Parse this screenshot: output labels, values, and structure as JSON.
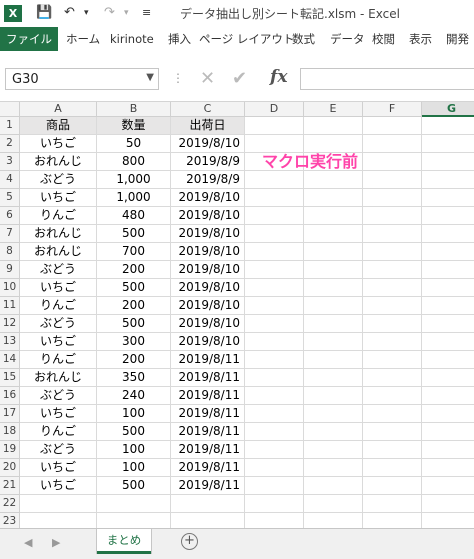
{
  "window": {
    "app_icon": "X",
    "title": "データ抽出し別シート転記.xlsm - Excel"
  },
  "quick_access": {
    "save_icon": "💾",
    "undo_icon": "↶",
    "redo_icon": "↷",
    "dropdown_icon": "▾",
    "customize_icon": "≡"
  },
  "ribbon": {
    "tabs": [
      "ファイル",
      "ホーム",
      "kirinote",
      "挿入",
      "ページ レイアウト",
      "数式",
      "データ",
      "校閲",
      "表示",
      "開発"
    ]
  },
  "formula_bar": {
    "name_box": "G30",
    "name_box_arrow": "▼",
    "dots": "⋮",
    "cancel_icon": "✕",
    "enter_icon": "✔",
    "fx_label": "fx",
    "formula": ""
  },
  "sheet": {
    "columns": [
      "A",
      "B",
      "C",
      "D",
      "E",
      "F",
      "G"
    ],
    "selected_column": "G",
    "rows": [
      "1",
      "2",
      "3",
      "4",
      "5",
      "6",
      "7",
      "8",
      "9",
      "10",
      "11",
      "12",
      "13",
      "14",
      "15",
      "16",
      "17",
      "18",
      "19",
      "20",
      "21",
      "22",
      "23"
    ],
    "header": [
      "商品",
      "数量",
      "出荷日"
    ],
    "data": [
      [
        "いちご",
        "50",
        "2019/8/10"
      ],
      [
        "おれんじ",
        "800",
        "2019/8/9"
      ],
      [
        "ぶどう",
        "1,000",
        "2019/8/9"
      ],
      [
        "いちご",
        "1,000",
        "2019/8/10"
      ],
      [
        "りんご",
        "480",
        "2019/8/10"
      ],
      [
        "おれんじ",
        "500",
        "2019/8/10"
      ],
      [
        "おれんじ",
        "700",
        "2019/8/10"
      ],
      [
        "ぶどう",
        "200",
        "2019/8/10"
      ],
      [
        "いちご",
        "500",
        "2019/8/10"
      ],
      [
        "りんご",
        "200",
        "2019/8/10"
      ],
      [
        "ぶどう",
        "500",
        "2019/8/10"
      ],
      [
        "いちご",
        "300",
        "2019/8/10"
      ],
      [
        "りんご",
        "200",
        "2019/8/11"
      ],
      [
        "おれんじ",
        "350",
        "2019/8/11"
      ],
      [
        "ぶどう",
        "240",
        "2019/8/11"
      ],
      [
        "いちご",
        "100",
        "2019/8/11"
      ],
      [
        "りんご",
        "500",
        "2019/8/11"
      ],
      [
        "ぶどう",
        "100",
        "2019/8/11"
      ],
      [
        "いちご",
        "100",
        "2019/8/11"
      ],
      [
        "いちご",
        "500",
        "2019/8/11"
      ]
    ],
    "annotation": "マクロ実行前",
    "annotation_color": "#ff44aa"
  },
  "sheet_tabs": {
    "prev_icon": "◀",
    "next_icon": "▶",
    "tabs": [
      "まとめ"
    ],
    "add_icon": "+"
  },
  "colors": {
    "excel_green": "#217346",
    "header_fill": "#e7e6e6"
  }
}
